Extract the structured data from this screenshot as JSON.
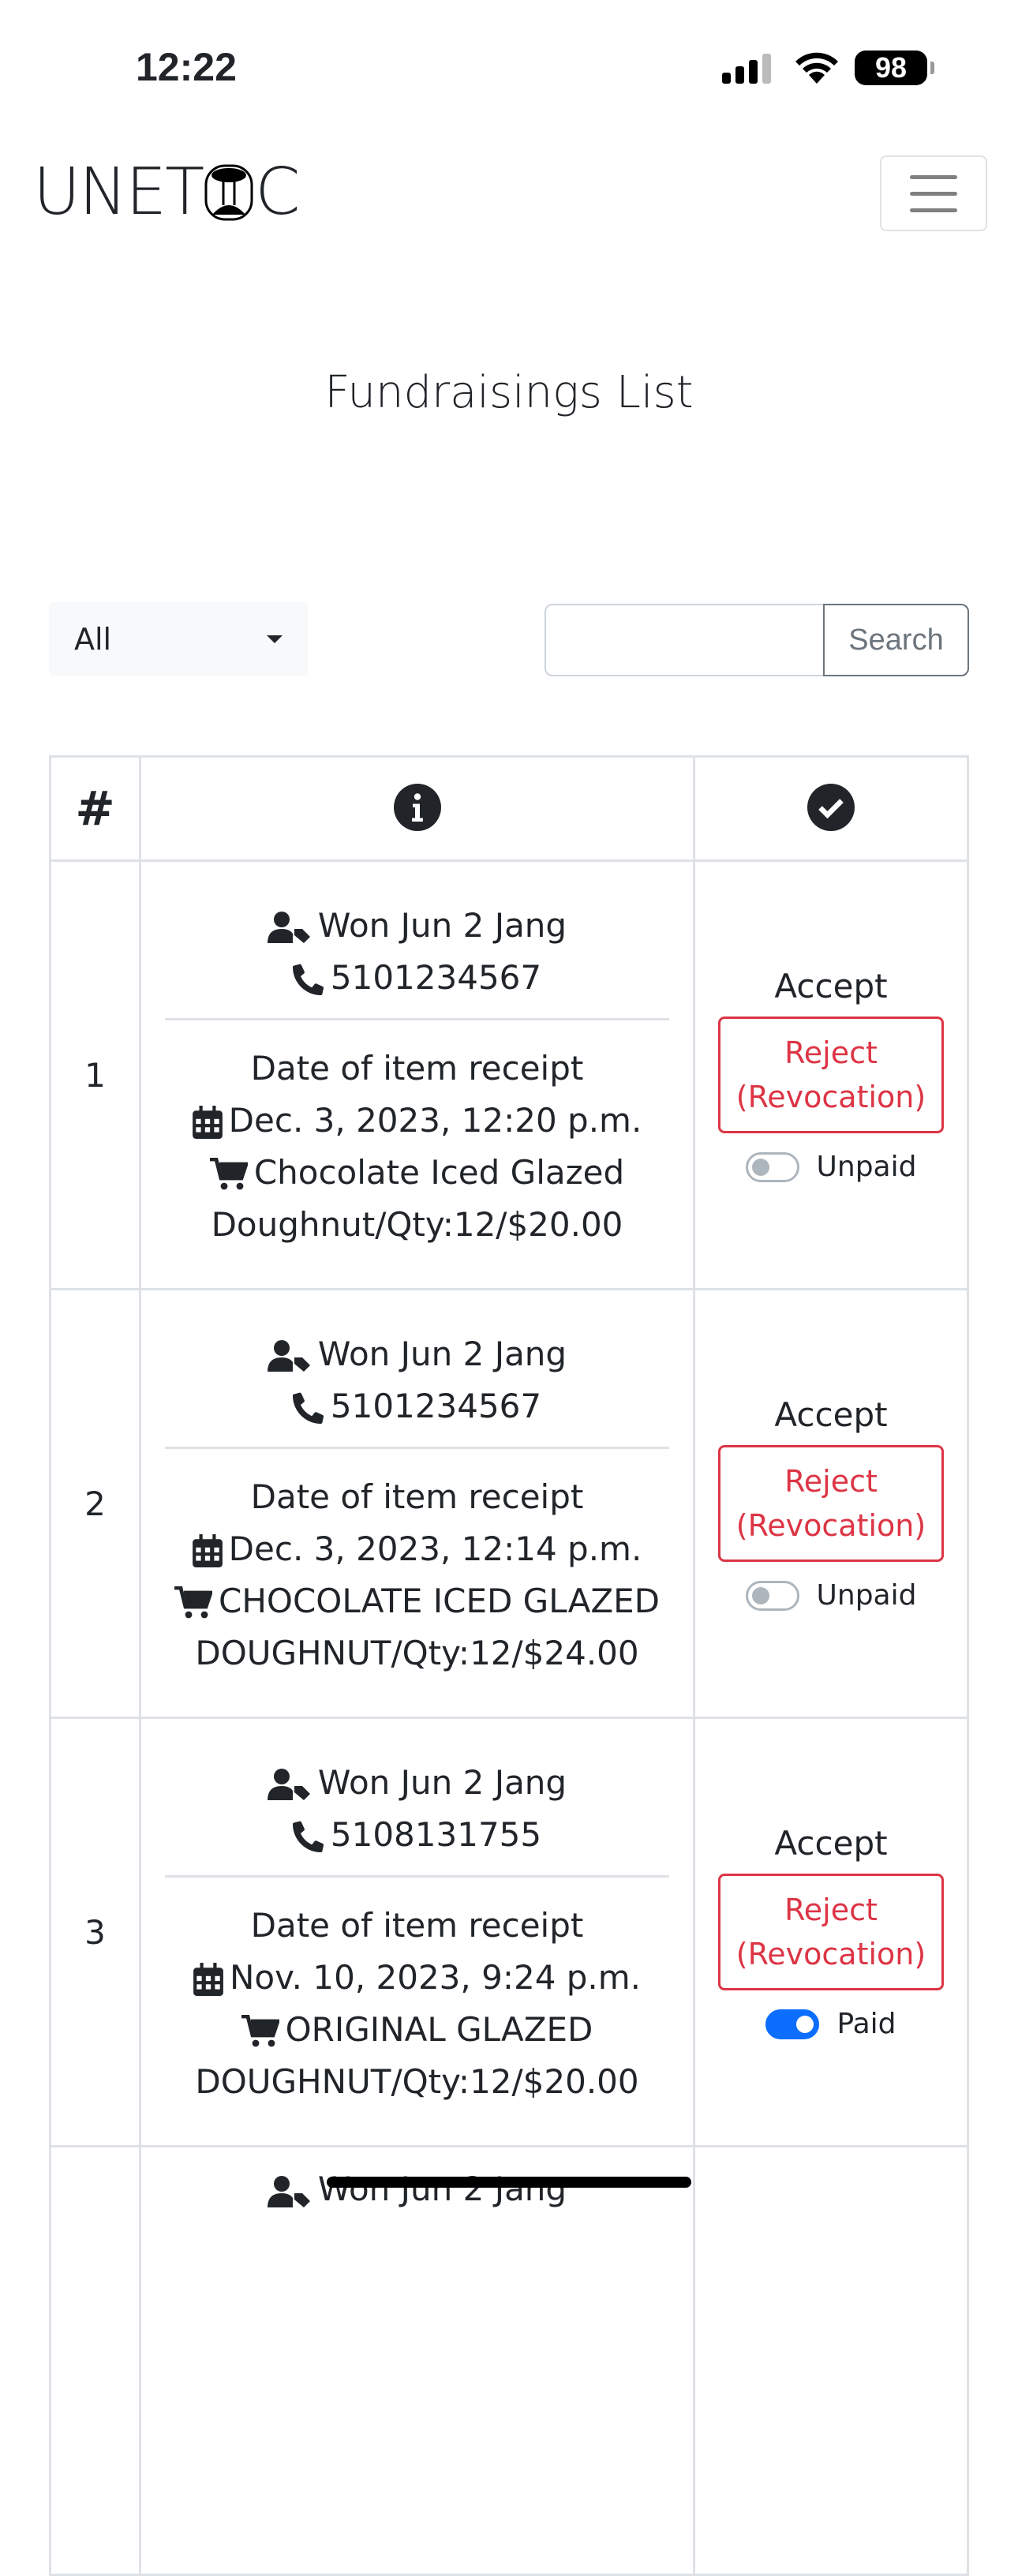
{
  "status_bar": {
    "time": "12:22",
    "battery": "98"
  },
  "header": {
    "logo": "UNETIC"
  },
  "page_title": "Fundraisings List",
  "filter": {
    "selected": "All"
  },
  "search": {
    "placeholder": "",
    "value": "",
    "button": "Search"
  },
  "table": {
    "headers": [
      "#",
      "info-icon",
      "check-circle-icon"
    ],
    "rows": [
      {
        "num": "1",
        "name": "Won Jun 2 Jang",
        "phone": "5101234567",
        "date_label": "Date of item receipt",
        "date": "Dec. 3, 2023, 12:20 p.m.",
        "item_line1": "Chocolate Iced Glazed",
        "item_line2": "Doughnut/Qty:12/$20.00",
        "status": "Accept",
        "reject_line1": "Reject",
        "reject_line2": "(Revocation)",
        "paid": false,
        "paid_label": "Unpaid"
      },
      {
        "num": "2",
        "name": "Won Jun 2 Jang",
        "phone": "5101234567",
        "date_label": "Date of item receipt",
        "date": "Dec. 3, 2023, 12:14 p.m.",
        "item_line1": "CHOCOLATE ICED GLAZED",
        "item_line2": "DOUGHNUT/Qty:12/$24.00",
        "status": "Accept",
        "reject_line1": "Reject",
        "reject_line2": "(Revocation)",
        "paid": false,
        "paid_label": "Unpaid"
      },
      {
        "num": "3",
        "name": "Won Jun 2 Jang",
        "phone": "5108131755",
        "date_label": "Date of item receipt",
        "date": "Nov. 10, 2023, 9:24 p.m.",
        "item_line1": "ORIGINAL GLAZED",
        "item_line2": "DOUGHNUT/Qty:12/$20.00",
        "status": "Accept",
        "reject_line1": "Reject",
        "reject_line2": "(Revocation)",
        "paid": true,
        "paid_label": "Paid"
      },
      {
        "num": "",
        "name": "Won Jun 2 Jang"
      }
    ]
  },
  "colors": {
    "danger": "#dc3545",
    "primary": "#0d6efd",
    "border": "#dee2e6"
  }
}
